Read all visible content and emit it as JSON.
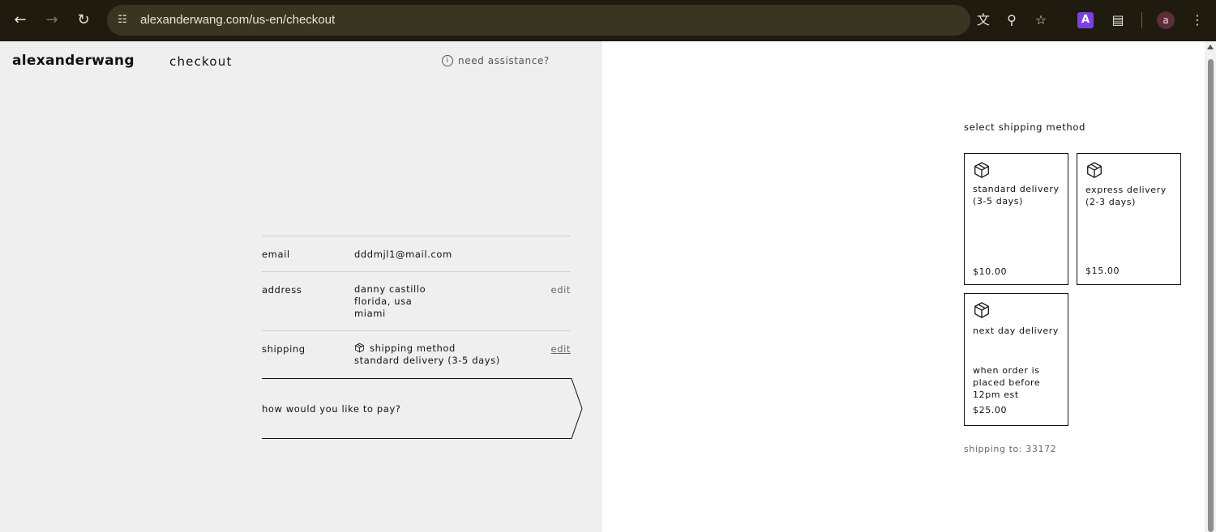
{
  "browser": {
    "url": "alexanderwang.com/us-en/checkout",
    "profile_initial": "a",
    "extension_label": "A",
    "icons": [
      "back-icon",
      "forward-icon",
      "reload-icon",
      "site-info-icon",
      "translate-icon",
      "zoom-icon",
      "bookmark-star-icon",
      "extension-icon",
      "extensions-puzzle-icon",
      "menu-dots-icon"
    ]
  },
  "header": {
    "brand": "alexanderwang",
    "title": "checkout",
    "assistance": "need assistance?"
  },
  "summary": {
    "email": {
      "label": "email",
      "value": "dddmjl1@mail.com"
    },
    "address": {
      "label": "address",
      "lines": [
        "danny castillo",
        "florida, usa",
        "miami"
      ],
      "edit": "edit"
    },
    "shipping": {
      "label": "shipping",
      "method_heading": "shipping method",
      "method_value": "standard delivery (3-5 days)",
      "edit": "edit"
    },
    "payment_prompt": "how would you like to pay?"
  },
  "shipping_selector": {
    "title": "select shipping method",
    "options": [
      {
        "name": "standard delivery (3-5 days)",
        "note": "",
        "price": "$10.00"
      },
      {
        "name": "express delivery (2-3 days)",
        "note": "",
        "price": "$15.00"
      },
      {
        "name": "next day delivery",
        "note": "when order is placed before 12pm est",
        "price": "$25.00"
      }
    ],
    "ship_to": "shipping to: 33172"
  }
}
